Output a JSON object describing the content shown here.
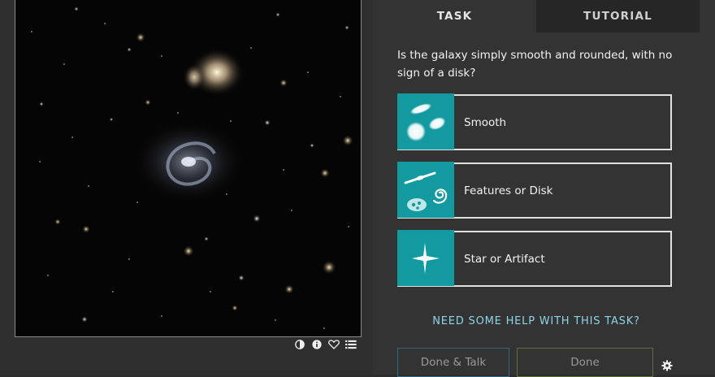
{
  "image_panel": {
    "icons": [
      "contrast-icon",
      "info-icon",
      "heart-icon",
      "collections-list-icon"
    ]
  },
  "tabs": [
    {
      "label": "TASK",
      "active": true
    },
    {
      "label": "TUTORIAL",
      "active": false
    }
  ],
  "task": {
    "question": "Is the galaxy simply smooth and rounded, with no sign of a disk?",
    "answers": [
      {
        "label": "Smooth",
        "icon": "smooth-galaxy-icon"
      },
      {
        "label": "Features or Disk",
        "icon": "features-disk-icon"
      },
      {
        "label": "Star or Artifact",
        "icon": "star-artifact-icon"
      }
    ],
    "help_link": "NEED SOME HELP WITH THIS TASK?"
  },
  "footer": {
    "done_talk_label": "Done & Talk",
    "done_label": "Done",
    "settings_icon": "gear-icon"
  },
  "colors": {
    "accent_teal": "#129aa0",
    "help_link": "#8fd3e6",
    "panel_bg": "#333333",
    "tab_inactive_bg": "#262626"
  }
}
